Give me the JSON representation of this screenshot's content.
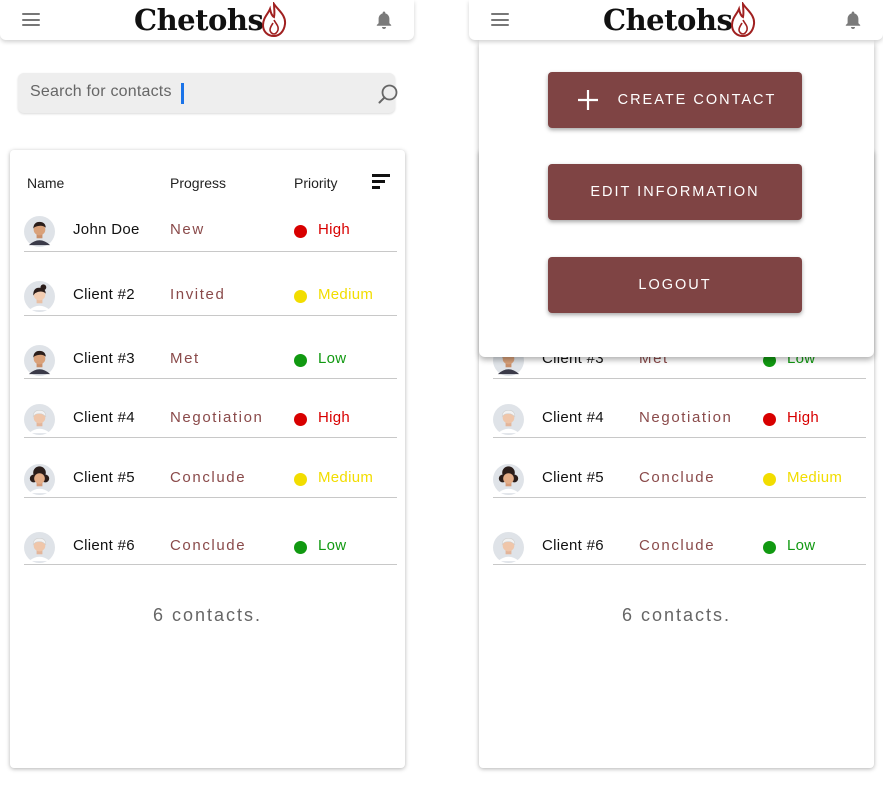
{
  "brand": {
    "name": "Chetohs"
  },
  "search": {
    "placeholder": "Search for contacts"
  },
  "columns": {
    "name": "Name",
    "progress": "Progress",
    "priority": "Priority"
  },
  "contacts": [
    {
      "name": "John Doe",
      "progress": "New",
      "priority": "High",
      "priority_color": "#d80000",
      "avatar": "avatar-male-dark-hair"
    },
    {
      "name": "Client #2",
      "progress": "Invited",
      "priority": "Medium",
      "priority_color": "#f2dd00",
      "avatar": "avatar-female-bun"
    },
    {
      "name": "Client #3",
      "progress": "Met",
      "priority": "Low",
      "priority_color": "#119911",
      "avatar": "avatar-male-dark-hair"
    },
    {
      "name": "Client #4",
      "progress": "Negotiation",
      "priority": "High",
      "priority_color": "#d80000",
      "avatar": "avatar-older-white-hair"
    },
    {
      "name": "Client #5",
      "progress": "Conclude",
      "priority": "Medium",
      "priority_color": "#f2dd00",
      "avatar": "avatar-female-curly-hair"
    },
    {
      "name": "Client #6",
      "progress": "Conclude",
      "priority": "Low",
      "priority_color": "#119911",
      "avatar": "avatar-older-white-hair"
    }
  ],
  "footer": {
    "count_text": "6 contacts."
  },
  "menu": {
    "create": "CREATE CONTACT",
    "edit": "EDIT INFORMATION",
    "logout": "LOGOUT"
  },
  "colors": {
    "brand_button": "#7f4444",
    "progress_text": "#8a4a4a",
    "flame": "#a02020",
    "search_caret": "#1a73e8"
  }
}
